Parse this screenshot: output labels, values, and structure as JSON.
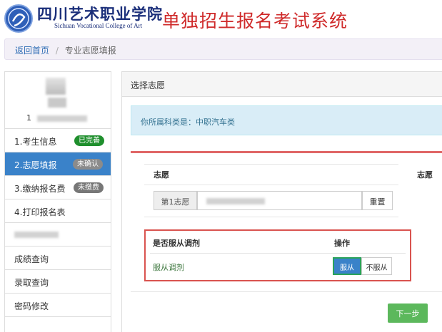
{
  "header": {
    "school_name_cn": "四川艺术职业学院",
    "school_name_en": "Sichuan Vocational College of Art",
    "system_title": "单独招生报名考试系统"
  },
  "breadcrumb": {
    "home": "返回首页",
    "separator": "/",
    "current": "专业志愿填报"
  },
  "sidebar": {
    "profile_prefix": "1",
    "items": [
      {
        "label": "1.考生信息",
        "badge": "已完善",
        "badge_color": "#1f8f2d"
      },
      {
        "label": "2.志愿填报",
        "badge": "未确认",
        "badge_color": "#8b8b8b",
        "active": true
      },
      {
        "label": "3.缴纳报名费",
        "badge": "未缴费",
        "badge_color": "#777777"
      },
      {
        "label": "4.打印报名表"
      },
      {
        "label": ""
      },
      {
        "label": "成绩查询"
      },
      {
        "label": "录取查询"
      },
      {
        "label": "密码修改"
      }
    ]
  },
  "main": {
    "panel_title": "选择志愿",
    "info": "你所属科类是：中职汽车类",
    "volunteer_col": "志愿",
    "volunteer_col_right": "志愿",
    "choice_label": "第1志愿",
    "reset_label": "重置",
    "adjust": {
      "header_obey": "是否服从调剂",
      "header_action": "操作",
      "value": "服从调剂",
      "yes_label": "服从",
      "no_label": "不服从"
    },
    "next_label": "下一步"
  },
  "colors": {
    "accent_blue": "#3a82c9",
    "title_red": "#cf2a2a",
    "success_green": "#5cb85c",
    "highlight_red": "#d9534f"
  }
}
